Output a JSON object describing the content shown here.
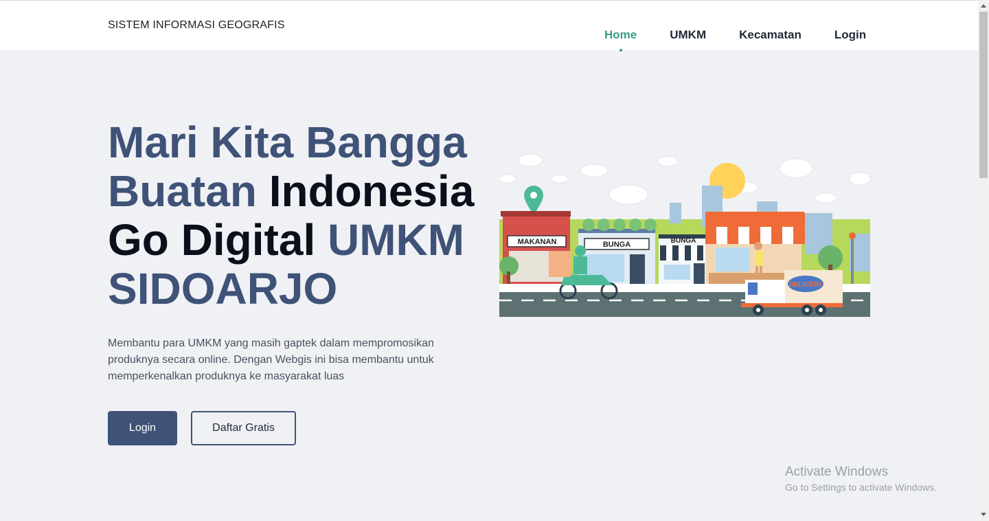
{
  "navbar": {
    "brand": "SISTEM INFORMASI GEOGRAFIS",
    "items": [
      {
        "label": "Home",
        "active": true
      },
      {
        "label": "UMKM",
        "active": false
      },
      {
        "label": "Kecamatan",
        "active": false
      },
      {
        "label": "Login",
        "active": false
      }
    ]
  },
  "hero": {
    "title_line1": "Mari Kita Bangga",
    "title_line2a": "Buatan",
    "title_line2b": "Indonesia",
    "title_line3a": "Go Digital",
    "title_line3b": "UMKM",
    "title_line4": "SIDOARJO",
    "description": "Membantu para UMKM yang masih gaptek dalam mempromosikan produknya secara online. Dengan Webgis ini bisa membantu untuk memperkenalkan produknya ke masyarakat luas",
    "login_button": "Login",
    "signup_button": "Daftar Gratis"
  },
  "illustration": {
    "shop1": "MAKANAN",
    "shop2": "BUNGA",
    "shop3": "BUNGA",
    "truck": "DELIVERY"
  },
  "watermark": {
    "line1": "Activate Windows",
    "line2": "Go to Settings to activate Windows."
  },
  "colors": {
    "primary": "#3f5277",
    "accent": "#3a9a8a",
    "background": "#f0f1f5"
  }
}
